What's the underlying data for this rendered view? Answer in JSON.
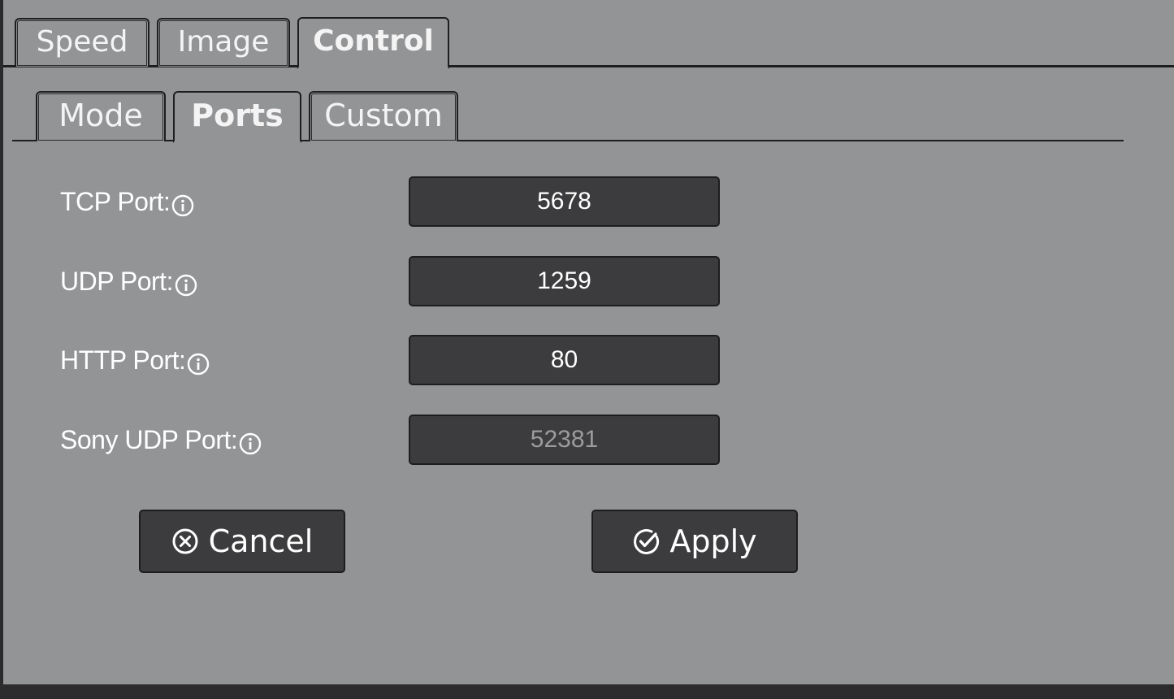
{
  "top_tabs": [
    {
      "label": "Speed",
      "active": false
    },
    {
      "label": "Image",
      "active": false
    },
    {
      "label": "Control",
      "active": true
    }
  ],
  "sub_tabs": [
    {
      "label": "Mode",
      "active": false
    },
    {
      "label": "Ports",
      "active": true
    },
    {
      "label": "Custom",
      "active": false
    }
  ],
  "fields": [
    {
      "label": "TCP Port:",
      "value": "5678",
      "disabled": false,
      "icon": "info-icon"
    },
    {
      "label": "UDP Port:",
      "value": "1259",
      "disabled": false,
      "icon": "info-icon"
    },
    {
      "label": "HTTP Port:",
      "value": "80",
      "disabled": false,
      "icon": "info-icon"
    },
    {
      "label": "Sony UDP Port:",
      "value": "52381",
      "disabled": true,
      "icon": "info-icon"
    }
  ],
  "buttons": {
    "cancel_label": "Cancel",
    "cancel_icon": "circle-x-icon",
    "apply_label": "Apply",
    "apply_icon": "circle-check-icon"
  },
  "colors": {
    "background": "#939496",
    "input_bg": "#3c3c3e",
    "border": "#1e1e1f",
    "text": "#ffffff",
    "disabled_text": "#9c9c9e"
  }
}
